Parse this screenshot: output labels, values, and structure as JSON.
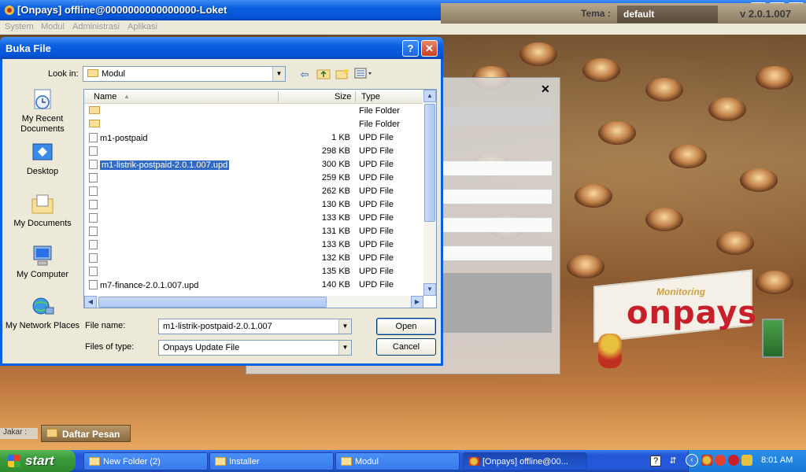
{
  "app": {
    "title": "[Onpays] offline@0000000000000000-Loket",
    "menu": [
      "System",
      "Modul",
      "Administrasi",
      "Aplikasi"
    ],
    "tema_label": "Tema :",
    "tema_value": "default",
    "version": "v 2.0.1.007",
    "logo_monitoring": "Monitoring",
    "logo_name": "onpays",
    "info_label": "Jakar :",
    "daftar_pesan": "Daftar Pesan"
  },
  "dialog": {
    "title": "Buka File",
    "help": "?",
    "close": "✕",
    "look_in_label": "Look in:",
    "look_in_value": "Modul",
    "places": [
      "My Recent Documents",
      "Desktop",
      "My Documents",
      "My Computer",
      "My Network Places"
    ],
    "columns": [
      "Name",
      "Size",
      "Type"
    ],
    "files": [
      {
        "name": "",
        "size": "",
        "type": "File Folder",
        "kind": "folder"
      },
      {
        "name": "",
        "size": "",
        "type": "File Folder",
        "kind": "folder"
      },
      {
        "name": "m1-postpaid",
        "size": "1 KB",
        "type": "UPD File",
        "kind": "file"
      },
      {
        "name": "",
        "size": "298 KB",
        "type": "UPD File",
        "kind": "file"
      },
      {
        "name": "m1-listrik-postpaid-2.0.1.007.upd",
        "size": "300 KB",
        "type": "UPD File",
        "kind": "file",
        "selected": true
      },
      {
        "name": "",
        "size": "259 KB",
        "type": "UPD File",
        "kind": "file"
      },
      {
        "name": "",
        "size": "262 KB",
        "type": "UPD File",
        "kind": "file"
      },
      {
        "name": "",
        "size": "130 KB",
        "type": "UPD File",
        "kind": "file"
      },
      {
        "name": "",
        "size": "133 KB",
        "type": "UPD File",
        "kind": "file"
      },
      {
        "name": "",
        "size": "131 KB",
        "type": "UPD File",
        "kind": "file"
      },
      {
        "name": "",
        "size": "133 KB",
        "type": "UPD File",
        "kind": "file"
      },
      {
        "name": "",
        "size": "132 KB",
        "type": "UPD File",
        "kind": "file"
      },
      {
        "name": "",
        "size": "135 KB",
        "type": "UPD File",
        "kind": "file"
      },
      {
        "name": "m7-finance-2.0.1.007.upd",
        "size": "140 KB",
        "type": "UPD File",
        "kind": "file"
      }
    ],
    "file_name_label": "File name:",
    "file_name_value": "m1-listrik-postpaid-2.0.1.007",
    "file_type_label": "Files of type:",
    "file_type_value": "Onpays Update File",
    "open_label": "Open",
    "cancel_label": "Cancel"
  },
  "taskbar": {
    "start_label": "start",
    "tasks": [
      "New Folder (2)",
      "Installer",
      "Modul",
      "[Onpays] offline@00..."
    ],
    "clock": "8:01 AM"
  }
}
